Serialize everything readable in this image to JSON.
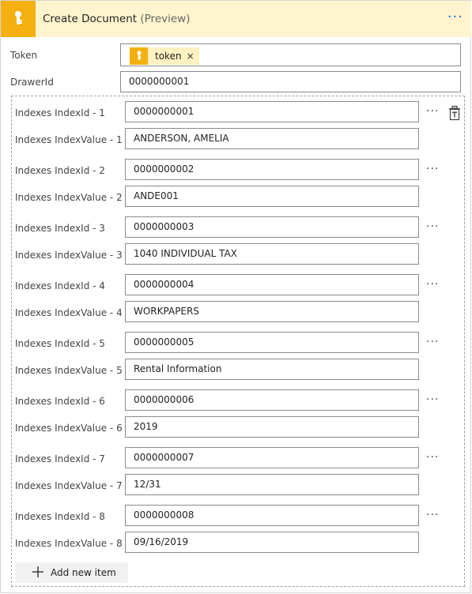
{
  "header": {
    "title": "Create Document",
    "subtitle": "(Preview)",
    "more_label": "···",
    "icon": "key-icon",
    "accent_color": "#f3b00f",
    "background_color": "#fff4ce"
  },
  "token_field": {
    "label": "Token",
    "chip_label": "token",
    "chip_close": "×",
    "chip_icon": "key-icon"
  },
  "drawer_field": {
    "label": "DrawerId",
    "value": "0000000001"
  },
  "indexes": [
    {
      "id_label": "Indexes IndexId - 1",
      "id_value": "0000000001",
      "value_label": "Indexes IndexValue - 1",
      "value": "ANDERSON, AMELIA"
    },
    {
      "id_label": "Indexes IndexId - 2",
      "id_value": "0000000002",
      "value_label": "Indexes IndexValue - 2",
      "value": "ANDE001"
    },
    {
      "id_label": "Indexes IndexId - 3",
      "id_value": "0000000003",
      "value_label": "Indexes IndexValue - 3",
      "value": "1040 INDIVIDUAL TAX"
    },
    {
      "id_label": "Indexes IndexId - 4",
      "id_value": "0000000004",
      "value_label": "Indexes IndexValue - 4",
      "value": "WORKPAPERS"
    },
    {
      "id_label": "Indexes IndexId - 5",
      "id_value": "0000000005",
      "value_label": "Indexes IndexValue - 5",
      "value": "Rental Information"
    },
    {
      "id_label": "Indexes IndexId - 6",
      "id_value": "0000000006",
      "value_label": "Indexes IndexValue - 6",
      "value": "2019"
    },
    {
      "id_label": "Indexes IndexId - 7",
      "id_value": "0000000007",
      "value_label": "Indexes IndexValue - 7",
      "value": "12/31"
    },
    {
      "id_label": "Indexes IndexId - 8",
      "id_value": "0000000008",
      "value_label": "Indexes IndexValue - 8",
      "value": "09/16/2019"
    }
  ],
  "row_more_label": "···",
  "delete_icon": "trash-icon",
  "add_item": {
    "label": "Add new item",
    "icon": "plus-icon"
  }
}
